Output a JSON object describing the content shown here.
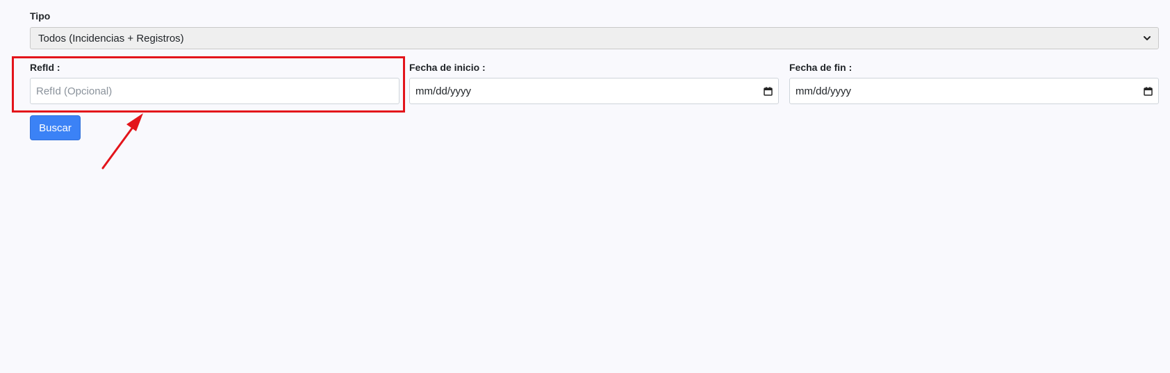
{
  "form": {
    "tipo": {
      "label": "Tipo",
      "selected": "Todos (Incidencias + Registros)"
    },
    "refid": {
      "label": "RefId :",
      "placeholder": "RefId (Opcional)",
      "value": ""
    },
    "fecha_inicio": {
      "label": "Fecha de inicio :",
      "value": "mm/dd/yyyy"
    },
    "fecha_fin": {
      "label": "Fecha de fin :",
      "value": "mm/dd/yyyy"
    },
    "buscar_label": "Buscar"
  },
  "icons": {
    "select_chevron": "chevron-down-icon",
    "date_picker": "calendar-icon"
  },
  "colors": {
    "background": "#f9f9fd",
    "primary_button": "#3b82f6",
    "highlight": "#e3141b",
    "select_background": "#efefef"
  }
}
